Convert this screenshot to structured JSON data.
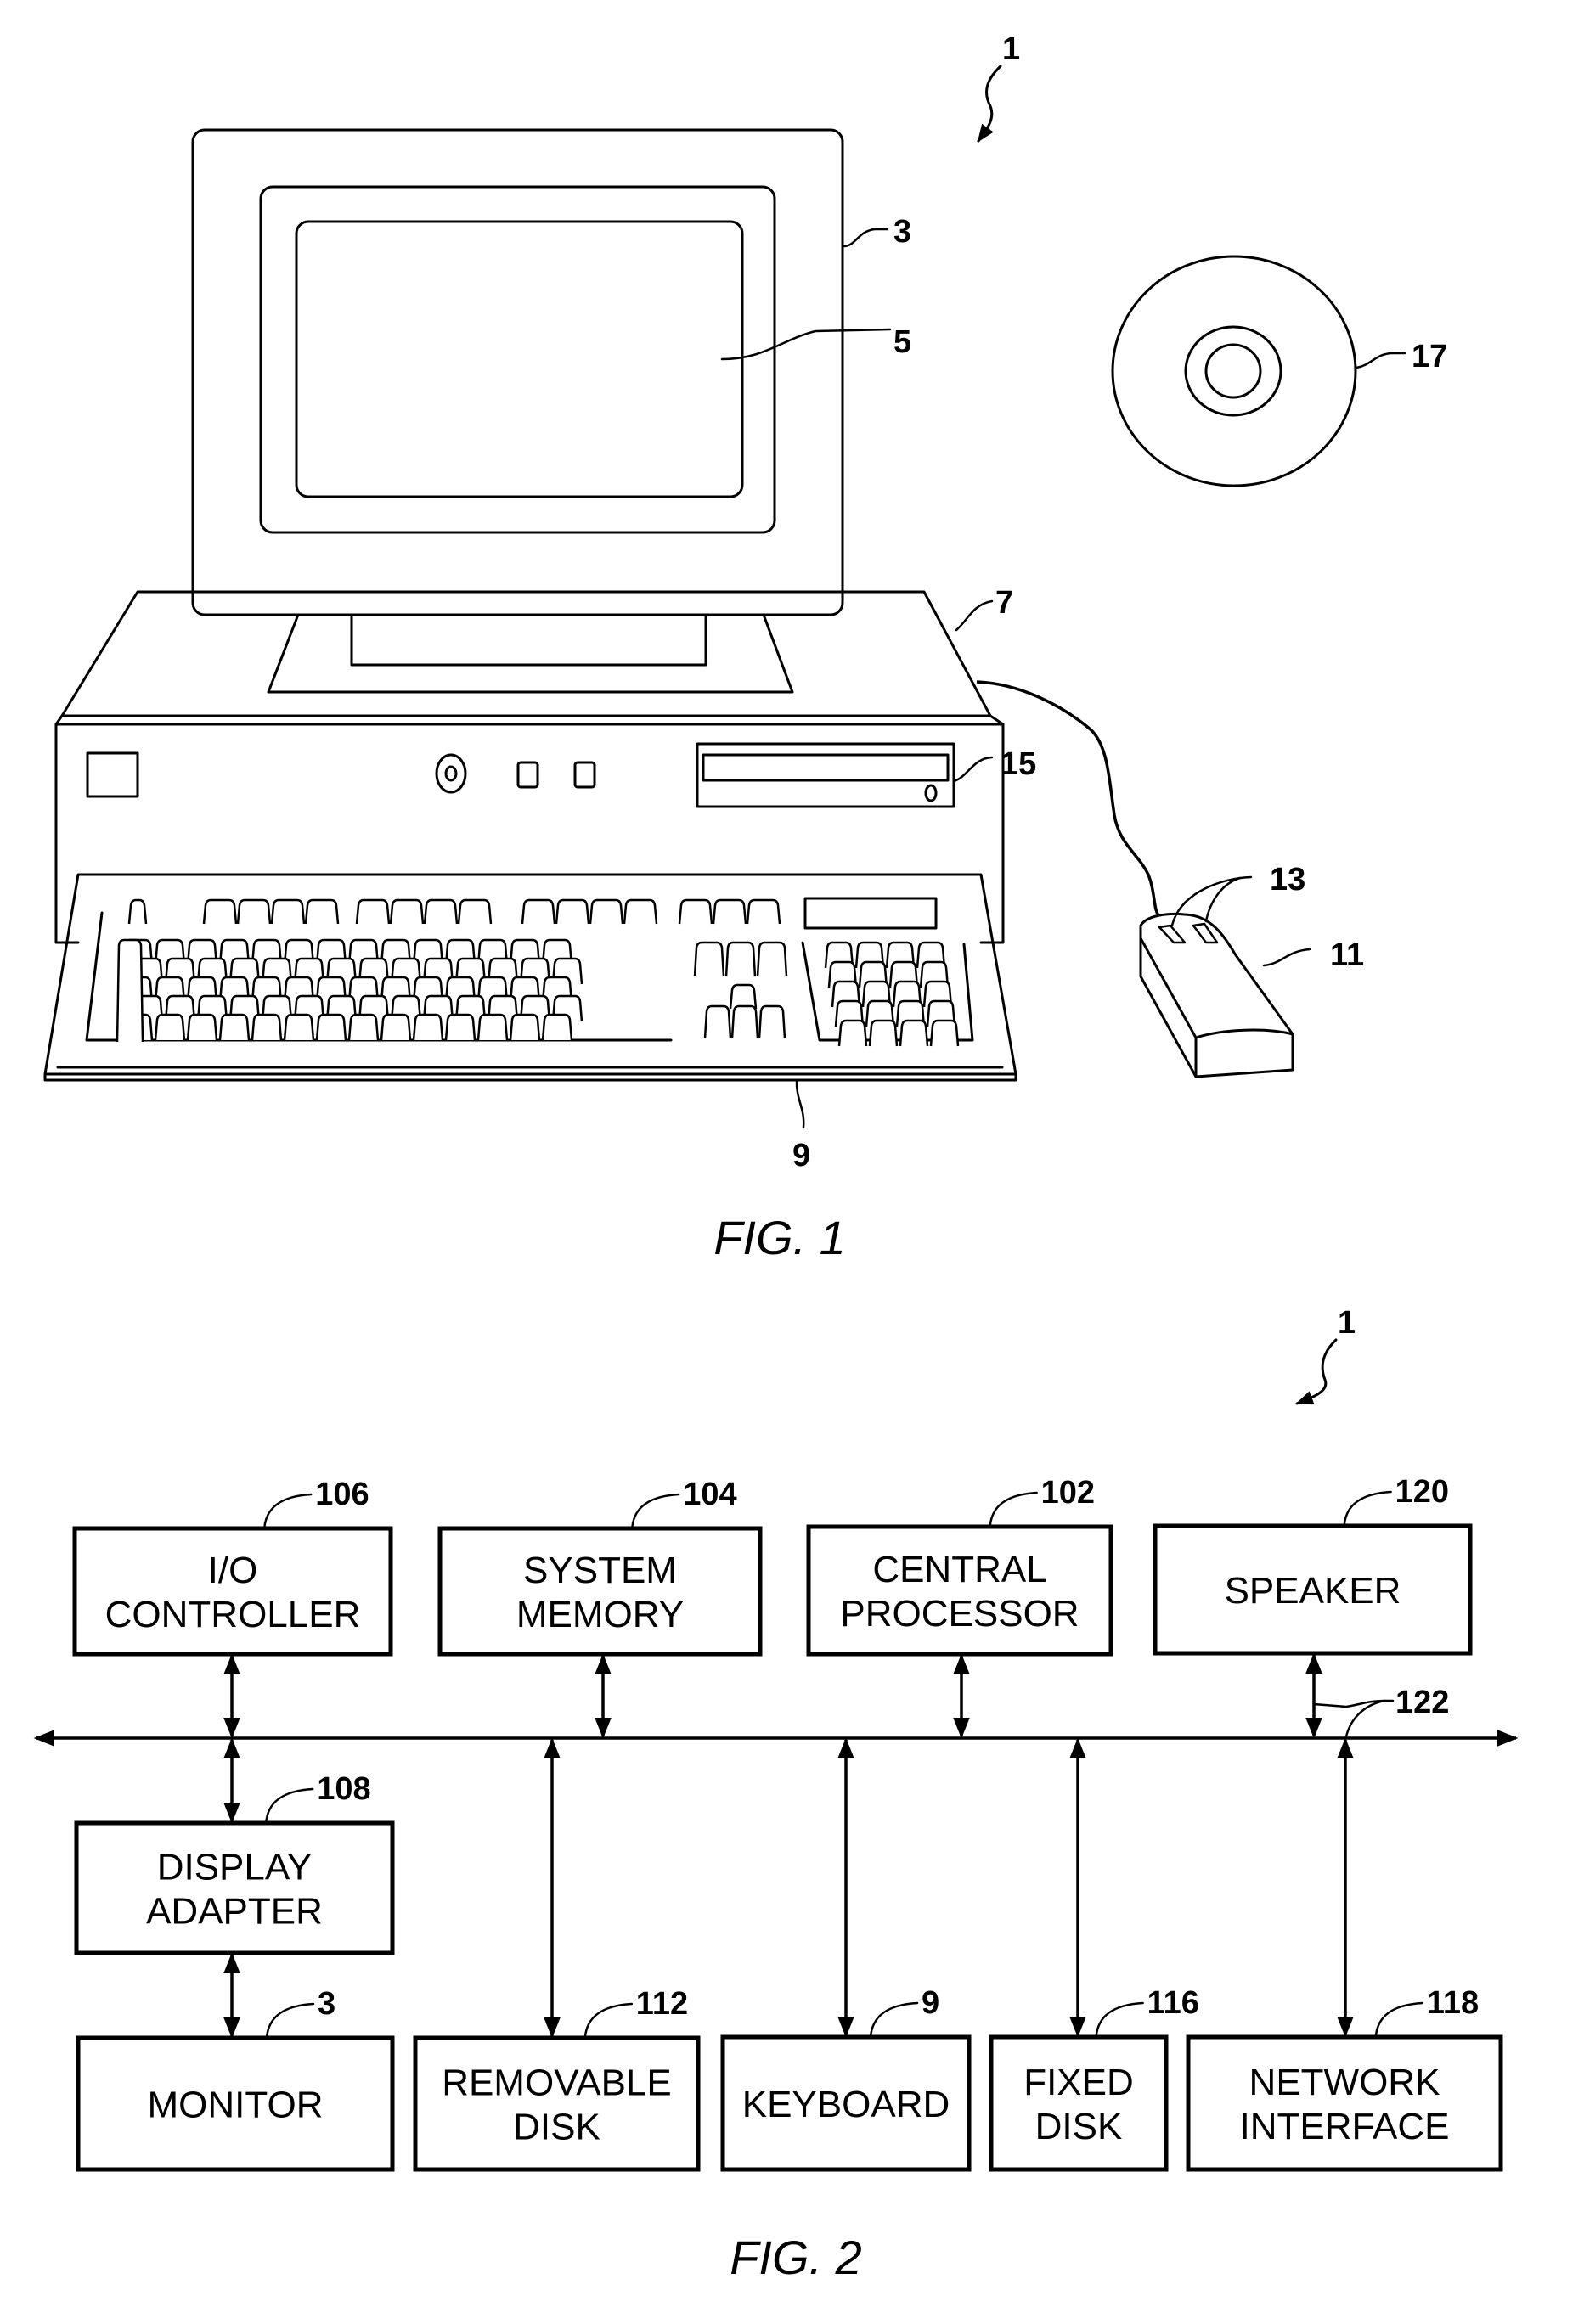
{
  "figure1": {
    "caption": "FIG. 1",
    "refs": {
      "system": "1",
      "monitor": "3",
      "screen": "5",
      "cabinet": "7",
      "keyboard": "9",
      "mouse": "11",
      "mouse_buttons": "13",
      "drive": "15",
      "disc": "17"
    }
  },
  "figure2": {
    "caption": "FIG. 2",
    "system_ref": "1",
    "bus_ref": "122",
    "blocks": [
      {
        "id": "io-controller",
        "lines": [
          "I/O",
          "CONTROLLER"
        ],
        "ref": "106"
      },
      {
        "id": "system-memory",
        "lines": [
          "SYSTEM",
          "MEMORY"
        ],
        "ref": "104"
      },
      {
        "id": "central-processor",
        "lines": [
          "CENTRAL",
          "PROCESSOR"
        ],
        "ref": "102"
      },
      {
        "id": "speaker",
        "lines": [
          "SPEAKER"
        ],
        "ref": "120"
      },
      {
        "id": "display-adapter",
        "lines": [
          "DISPLAY",
          "ADAPTER"
        ],
        "ref": "108"
      },
      {
        "id": "monitor",
        "lines": [
          "MONITOR"
        ],
        "ref": "3"
      },
      {
        "id": "removable-disk",
        "lines": [
          "REMOVABLE",
          "DISK"
        ],
        "ref": "112"
      },
      {
        "id": "keyboard",
        "lines": [
          "KEYBOARD"
        ],
        "ref": "9"
      },
      {
        "id": "fixed-disk",
        "lines": [
          "FIXED",
          "DISK"
        ],
        "ref": "116"
      },
      {
        "id": "network-interface",
        "lines": [
          "NETWORK",
          "INTERFACE"
        ],
        "ref": "118"
      }
    ]
  }
}
